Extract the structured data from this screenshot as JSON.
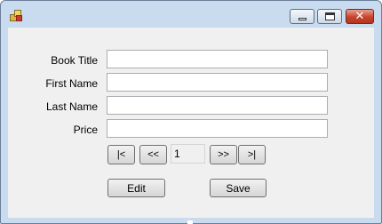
{
  "window": {
    "icon": "app-icon",
    "controls": {
      "minimize": "minimize-icon",
      "maximize": "maximize-icon",
      "close": "close-icon"
    },
    "colors": {
      "frame": "#c9dbee",
      "client": "#f0f0f0",
      "close": "#c7432c"
    }
  },
  "form": {
    "book_title_label": "Book Title",
    "first_name_label": "First Name",
    "last_name_label": "Last Name",
    "price_label": "Price",
    "book_title_value": "",
    "first_name_value": "",
    "last_name_value": "",
    "price_value": ""
  },
  "navigator": {
    "first_label": "|<",
    "prev_label": "<<",
    "position": "1",
    "next_label": ">>",
    "last_label": ">|"
  },
  "actions": {
    "edit_label": "Edit",
    "save_label": "Save"
  }
}
